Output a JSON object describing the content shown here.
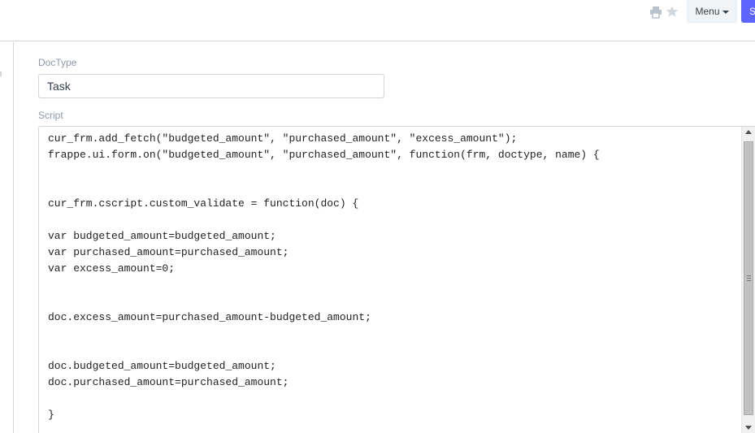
{
  "toolbar": {
    "menu_label": "Menu",
    "primary_label": "S",
    "icons": [
      "print-icon",
      "star-icon"
    ],
    "accent_color": "#5e64ff"
  },
  "form": {
    "doctype_label": "DocType",
    "doctype_value": "Task",
    "script_label": "Script",
    "script_lines": [
      "cur_frm.add_fetch(\"budgeted_amount\", \"purchased_amount\", \"excess_amount\");",
      "frappe.ui.form.on(\"budgeted_amount\", \"purchased_amount\", function(frm, doctype, name) {",
      "",
      "",
      "cur_frm.cscript.custom_validate = function(doc) {",
      "",
      "var budgeted_amount=budgeted_amount;",
      "var purchased_amount=purchased_amount;",
      "var excess_amount=0;",
      "",
      "",
      "doc.excess_amount=purchased_amount-budgeted_amount;",
      "",
      "",
      "doc.budgeted_amount=budgeted_amount;",
      "doc.purchased_amount=purchased_amount;",
      "",
      "}"
    ]
  }
}
